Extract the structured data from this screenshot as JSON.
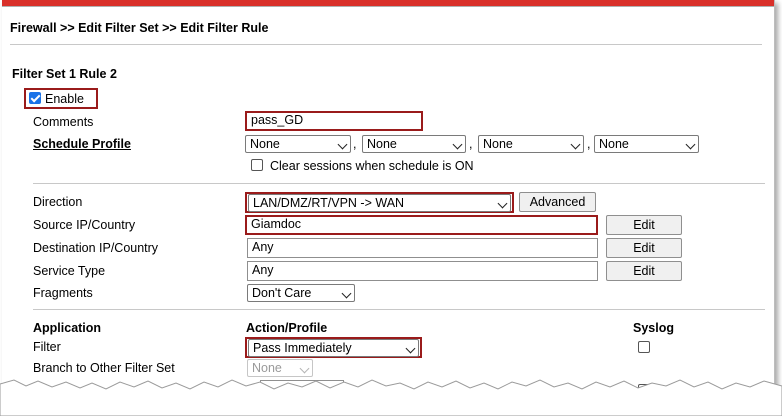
{
  "breadcrumb": "Firewall >> Edit Filter Set >> Edit Filter Rule",
  "section_title": "Filter Set 1 Rule 2",
  "enable": {
    "label": "Enable",
    "checked": true
  },
  "comments": {
    "label": "Comments",
    "value": "pass_GD"
  },
  "schedule": {
    "label": "Schedule Profile",
    "values": [
      "None",
      "None",
      "None",
      "None"
    ],
    "separator": ",",
    "clear_label": "Clear sessions when schedule is ON"
  },
  "direction": {
    "label": "Direction",
    "value": "LAN/DMZ/RT/VPN -> WAN",
    "advanced_label": "Advanced"
  },
  "source": {
    "label": "Source IP/Country",
    "value": "Giamdoc",
    "edit_label": "Edit"
  },
  "destination": {
    "label": "Destination IP/Country",
    "value": "Any",
    "edit_label": "Edit"
  },
  "service": {
    "label": "Service Type",
    "value": "Any",
    "edit_label": "Edit"
  },
  "fragments": {
    "label": "Fragments",
    "value": "Don't Care"
  },
  "table_headers": {
    "application": "Application",
    "action": "Action/Profile",
    "syslog": "Syslog"
  },
  "filter": {
    "label": "Filter",
    "value": "Pass Immediately"
  },
  "branch": {
    "label": "Branch to Other Filter Set",
    "value": "None"
  }
}
